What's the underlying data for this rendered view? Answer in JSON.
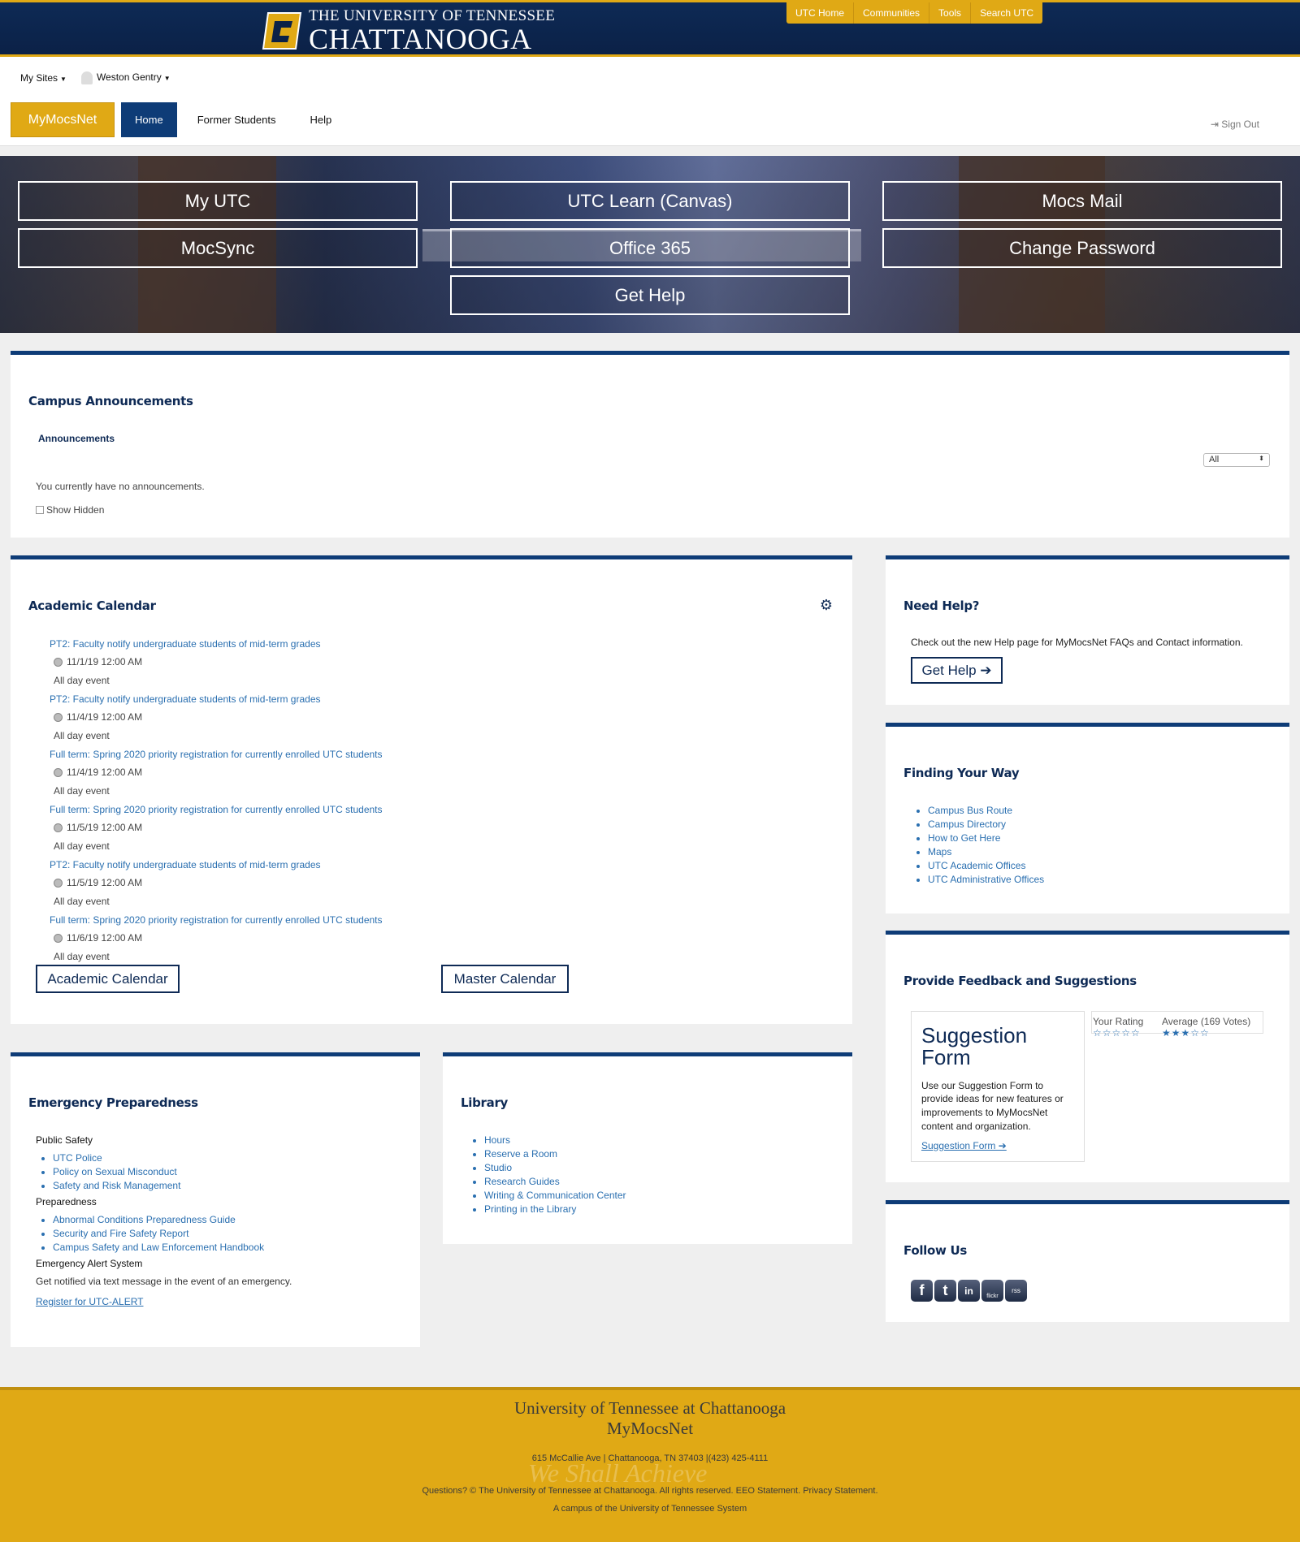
{
  "header": {
    "logo_line1": "THE UNIVERSITY OF TENNESSEE",
    "logo_line2": "CHATTANOOGA",
    "logo_glyph": "C",
    "util_links": [
      "UTC Home",
      "Communities",
      "Tools",
      "Search UTC"
    ]
  },
  "subbar": {
    "my_sites": "My Sites",
    "user_name": "Weston Gentry",
    "brand": "MyMocsNet",
    "nav": [
      "Home",
      "Former Students",
      "Help"
    ],
    "sign_out": "Sign Out"
  },
  "hero": {
    "buttons": [
      "My UTC",
      "UTC Learn (Canvas)",
      "Mocs Mail",
      "MocSync",
      "Office 365",
      "Change Password",
      "Get Help"
    ]
  },
  "announcements": {
    "title": "Campus Announcements",
    "tab": "Announcements",
    "filter_value": "All",
    "empty_text": "You currently have no announcements.",
    "show_hidden": "Show Hidden"
  },
  "calendar": {
    "title": "Academic Calendar",
    "events": [
      {
        "title": "PT2: Faculty notify undergraduate students of mid-term grades",
        "time": "11/1/19 12:00 AM",
        "note": "All day event"
      },
      {
        "title": "PT2: Faculty notify undergraduate students of mid-term grades",
        "time": "11/4/19 12:00 AM",
        "note": "All day event"
      },
      {
        "title": "Full term: Spring 2020 priority registration for currently enrolled UTC students",
        "time": "11/4/19 12:00 AM",
        "note": "All day event"
      },
      {
        "title": "Full term: Spring 2020 priority registration for currently enrolled UTC students",
        "time": "11/5/19 12:00 AM",
        "note": "All day event"
      },
      {
        "title": "PT2: Faculty notify undergraduate students of mid-term grades",
        "time": "11/5/19 12:00 AM",
        "note": "All day event"
      },
      {
        "title": "Full term: Spring 2020 priority registration for currently enrolled UTC students",
        "time": "11/6/19 12:00 AM",
        "note": "All day event"
      }
    ],
    "btn_academic": "Academic Calendar",
    "btn_master": "Master Calendar"
  },
  "need_help": {
    "title": "Need Help?",
    "text": "Check out the new Help page for MyMocsNet FAQs and Contact information.",
    "button": "Get Help ➔"
  },
  "finding": {
    "title": "Finding Your Way",
    "links": [
      "Campus Bus Route",
      "Campus Directory",
      "How to Get Here",
      "Maps",
      "UTC Academic Offices",
      "UTC Administrative Offices"
    ]
  },
  "feedback": {
    "title": "Provide Feedback and Suggestions",
    "card_title": "Suggestion Form",
    "card_text": "Use our Suggestion Form to provide ideas for new features or improvements to MyMocsNet content and organization.",
    "card_link": "Suggestion Form ➔",
    "your_rating": "Your Rating",
    "average": "Average (169 Votes)",
    "your_stars": "☆☆☆☆☆",
    "avg_stars": "★★★☆☆"
  },
  "follow": {
    "title": "Follow Us",
    "icons": [
      "f",
      "t",
      "in",
      "flickr",
      "rss"
    ]
  },
  "emergency": {
    "title": "Emergency Preparedness",
    "public_safety_head": "Public Safety",
    "public_safety": [
      "UTC Police",
      "Policy on Sexual Misconduct",
      "Safety and Risk Management"
    ],
    "preparedness_head": "Preparedness",
    "preparedness": [
      "Abnormal Conditions Preparedness Guide",
      "Security and Fire Safety Report",
      "Campus Safety and Law Enforcement Handbook"
    ],
    "alert_head": "Emergency Alert System",
    "alert_text": "Get notified via text message in the event of an emergency.",
    "alert_link": "Register for UTC-ALERT"
  },
  "library": {
    "title": "Library",
    "links": [
      "Hours",
      "Reserve a Room",
      "Studio",
      "Research Guides",
      "Writing & Communication Center",
      "Printing in the Library"
    ]
  },
  "footer": {
    "line1": "University of Tennessee at Chattanooga",
    "line2": "MyMocsNet",
    "address": "615 McCallie Ave | Chattanooga, TN 37403 |(423) 425-4111",
    "watermark": "We Shall Achieve",
    "questions": "Questions? © The University of Tennessee at Chattanooga. All rights reserved. EEO Statement. Privacy Statement.",
    "campus": "A campus of the University of Tennessee System"
  },
  "colors": {
    "navy": "#0e2a55",
    "blue_accent": "#0e3c77",
    "gold": "#e0a915",
    "link": "#2a6fb0"
  }
}
